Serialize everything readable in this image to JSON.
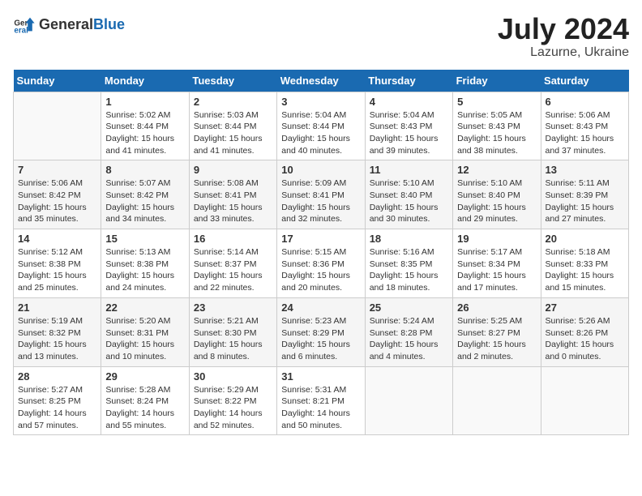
{
  "header": {
    "logo_general": "General",
    "logo_blue": "Blue",
    "month_year": "July 2024",
    "location": "Lazurne, Ukraine"
  },
  "days_of_week": [
    "Sunday",
    "Monday",
    "Tuesday",
    "Wednesday",
    "Thursday",
    "Friday",
    "Saturday"
  ],
  "weeks": [
    [
      {
        "day": "",
        "info": ""
      },
      {
        "day": "1",
        "info": "Sunrise: 5:02 AM\nSunset: 8:44 PM\nDaylight: 15 hours\nand 41 minutes."
      },
      {
        "day": "2",
        "info": "Sunrise: 5:03 AM\nSunset: 8:44 PM\nDaylight: 15 hours\nand 41 minutes."
      },
      {
        "day": "3",
        "info": "Sunrise: 5:04 AM\nSunset: 8:44 PM\nDaylight: 15 hours\nand 40 minutes."
      },
      {
        "day": "4",
        "info": "Sunrise: 5:04 AM\nSunset: 8:43 PM\nDaylight: 15 hours\nand 39 minutes."
      },
      {
        "day": "5",
        "info": "Sunrise: 5:05 AM\nSunset: 8:43 PM\nDaylight: 15 hours\nand 38 minutes."
      },
      {
        "day": "6",
        "info": "Sunrise: 5:06 AM\nSunset: 8:43 PM\nDaylight: 15 hours\nand 37 minutes."
      }
    ],
    [
      {
        "day": "7",
        "info": "Sunrise: 5:06 AM\nSunset: 8:42 PM\nDaylight: 15 hours\nand 35 minutes."
      },
      {
        "day": "8",
        "info": "Sunrise: 5:07 AM\nSunset: 8:42 PM\nDaylight: 15 hours\nand 34 minutes."
      },
      {
        "day": "9",
        "info": "Sunrise: 5:08 AM\nSunset: 8:41 PM\nDaylight: 15 hours\nand 33 minutes."
      },
      {
        "day": "10",
        "info": "Sunrise: 5:09 AM\nSunset: 8:41 PM\nDaylight: 15 hours\nand 32 minutes."
      },
      {
        "day": "11",
        "info": "Sunrise: 5:10 AM\nSunset: 8:40 PM\nDaylight: 15 hours\nand 30 minutes."
      },
      {
        "day": "12",
        "info": "Sunrise: 5:10 AM\nSunset: 8:40 PM\nDaylight: 15 hours\nand 29 minutes."
      },
      {
        "day": "13",
        "info": "Sunrise: 5:11 AM\nSunset: 8:39 PM\nDaylight: 15 hours\nand 27 minutes."
      }
    ],
    [
      {
        "day": "14",
        "info": "Sunrise: 5:12 AM\nSunset: 8:38 PM\nDaylight: 15 hours\nand 25 minutes."
      },
      {
        "day": "15",
        "info": "Sunrise: 5:13 AM\nSunset: 8:38 PM\nDaylight: 15 hours\nand 24 minutes."
      },
      {
        "day": "16",
        "info": "Sunrise: 5:14 AM\nSunset: 8:37 PM\nDaylight: 15 hours\nand 22 minutes."
      },
      {
        "day": "17",
        "info": "Sunrise: 5:15 AM\nSunset: 8:36 PM\nDaylight: 15 hours\nand 20 minutes."
      },
      {
        "day": "18",
        "info": "Sunrise: 5:16 AM\nSunset: 8:35 PM\nDaylight: 15 hours\nand 18 minutes."
      },
      {
        "day": "19",
        "info": "Sunrise: 5:17 AM\nSunset: 8:34 PM\nDaylight: 15 hours\nand 17 minutes."
      },
      {
        "day": "20",
        "info": "Sunrise: 5:18 AM\nSunset: 8:33 PM\nDaylight: 15 hours\nand 15 minutes."
      }
    ],
    [
      {
        "day": "21",
        "info": "Sunrise: 5:19 AM\nSunset: 8:32 PM\nDaylight: 15 hours\nand 13 minutes."
      },
      {
        "day": "22",
        "info": "Sunrise: 5:20 AM\nSunset: 8:31 PM\nDaylight: 15 hours\nand 10 minutes."
      },
      {
        "day": "23",
        "info": "Sunrise: 5:21 AM\nSunset: 8:30 PM\nDaylight: 15 hours\nand 8 minutes."
      },
      {
        "day": "24",
        "info": "Sunrise: 5:23 AM\nSunset: 8:29 PM\nDaylight: 15 hours\nand 6 minutes."
      },
      {
        "day": "25",
        "info": "Sunrise: 5:24 AM\nSunset: 8:28 PM\nDaylight: 15 hours\nand 4 minutes."
      },
      {
        "day": "26",
        "info": "Sunrise: 5:25 AM\nSunset: 8:27 PM\nDaylight: 15 hours\nand 2 minutes."
      },
      {
        "day": "27",
        "info": "Sunrise: 5:26 AM\nSunset: 8:26 PM\nDaylight: 15 hours\nand 0 minutes."
      }
    ],
    [
      {
        "day": "28",
        "info": "Sunrise: 5:27 AM\nSunset: 8:25 PM\nDaylight: 14 hours\nand 57 minutes."
      },
      {
        "day": "29",
        "info": "Sunrise: 5:28 AM\nSunset: 8:24 PM\nDaylight: 14 hours\nand 55 minutes."
      },
      {
        "day": "30",
        "info": "Sunrise: 5:29 AM\nSunset: 8:22 PM\nDaylight: 14 hours\nand 52 minutes."
      },
      {
        "day": "31",
        "info": "Sunrise: 5:31 AM\nSunset: 8:21 PM\nDaylight: 14 hours\nand 50 minutes."
      },
      {
        "day": "",
        "info": ""
      },
      {
        "day": "",
        "info": ""
      },
      {
        "day": "",
        "info": ""
      }
    ]
  ]
}
